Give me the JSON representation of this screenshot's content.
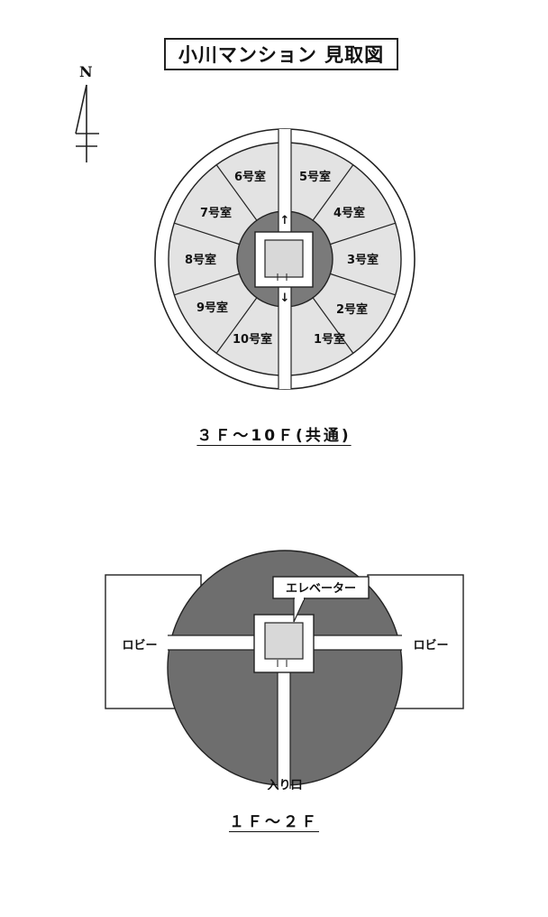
{
  "title": "小川マンション 見取図",
  "compass": {
    "label": "N"
  },
  "upper_plan": {
    "caption": "３Ｆ〜10Ｆ(共通)",
    "rooms": [
      "1号室",
      "2号室",
      "3号室",
      "4号室",
      "5号室",
      "6号室",
      "7号室",
      "8号室",
      "9号室",
      "10号室"
    ],
    "stair_up": "↑",
    "stair_down": "↓"
  },
  "lower_plan": {
    "caption": "１Ｆ〜２Ｆ",
    "elevator_label": "エレベーター",
    "lobby_left": "ロビー",
    "lobby_right": "ロビー",
    "entrance": "入り口"
  },
  "colors": {
    "room_fill": "#e3e3e3",
    "core_fill": "#7a7a7a",
    "lower_fill": "#6e6e6e",
    "line": "#222222"
  }
}
